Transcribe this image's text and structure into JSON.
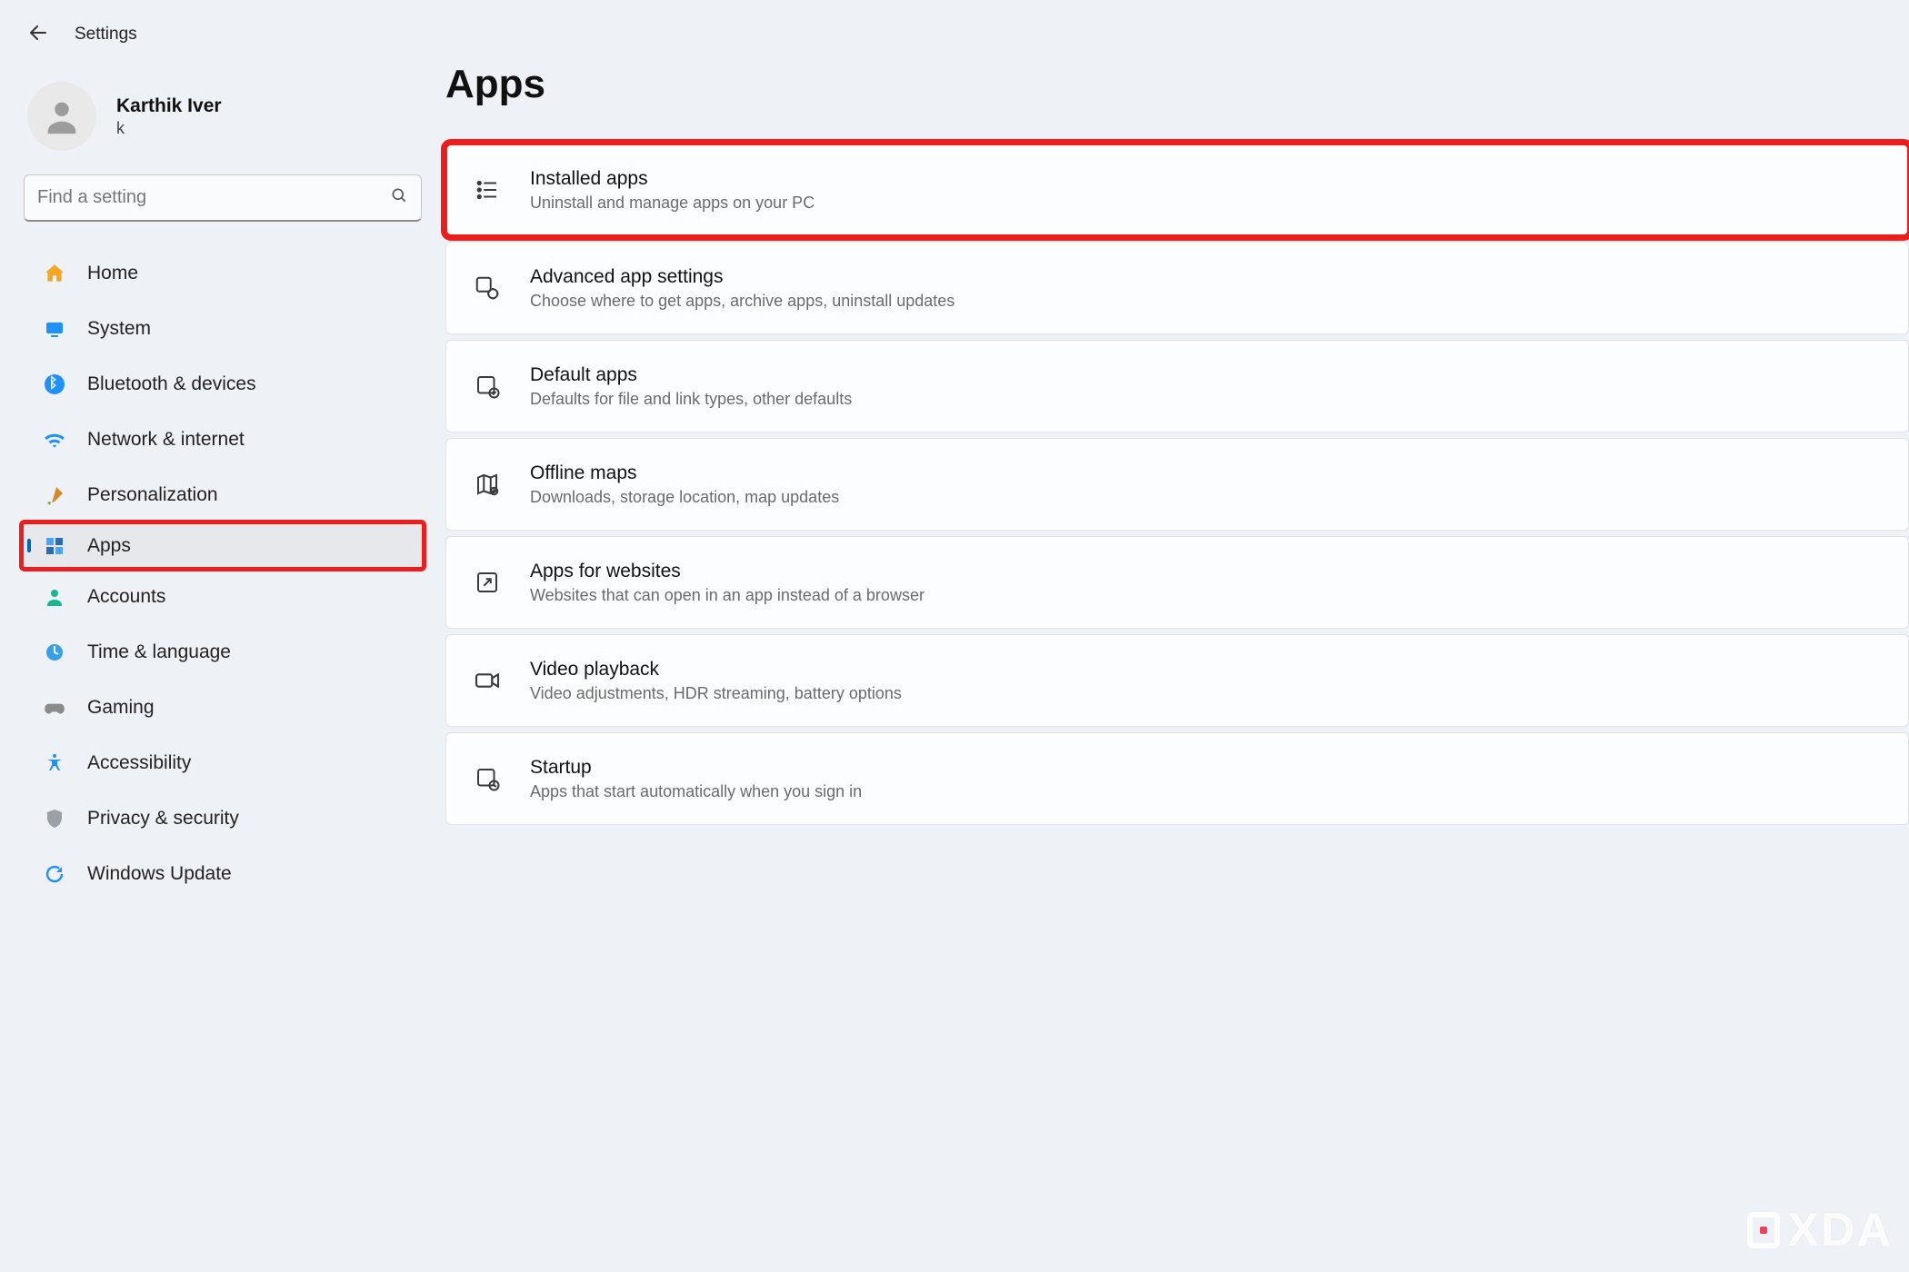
{
  "window": {
    "title": "Settings"
  },
  "profile": {
    "name": "Karthik Iver",
    "sub": "k"
  },
  "search": {
    "placeholder": "Find a setting"
  },
  "sidebar": {
    "items": [
      {
        "label": "Home"
      },
      {
        "label": "System"
      },
      {
        "label": "Bluetooth & devices"
      },
      {
        "label": "Network & internet"
      },
      {
        "label": "Personalization"
      },
      {
        "label": "Apps"
      },
      {
        "label": "Accounts"
      },
      {
        "label": "Time & language"
      },
      {
        "label": "Gaming"
      },
      {
        "label": "Accessibility"
      },
      {
        "label": "Privacy & security"
      },
      {
        "label": "Windows Update"
      }
    ],
    "selected_index": 5
  },
  "page": {
    "title": "Apps",
    "items": [
      {
        "title": "Installed apps",
        "desc": "Uninstall and manage apps on your PC"
      },
      {
        "title": "Advanced app settings",
        "desc": "Choose where to get apps, archive apps, uninstall updates"
      },
      {
        "title": "Default apps",
        "desc": "Defaults for file and link types, other defaults"
      },
      {
        "title": "Offline maps",
        "desc": "Downloads, storage location, map updates"
      },
      {
        "title": "Apps for websites",
        "desc": "Websites that can open in an app instead of a browser"
      },
      {
        "title": "Video playback",
        "desc": "Video adjustments, HDR streaming, battery options"
      },
      {
        "title": "Startup",
        "desc": "Apps that start automatically when you sign in"
      }
    ],
    "highlight_index": 0
  },
  "watermark": "XDA",
  "colors": {
    "accent": "#0067c0",
    "highlight": "#ef1c1c",
    "bg": "#eef1f6"
  }
}
